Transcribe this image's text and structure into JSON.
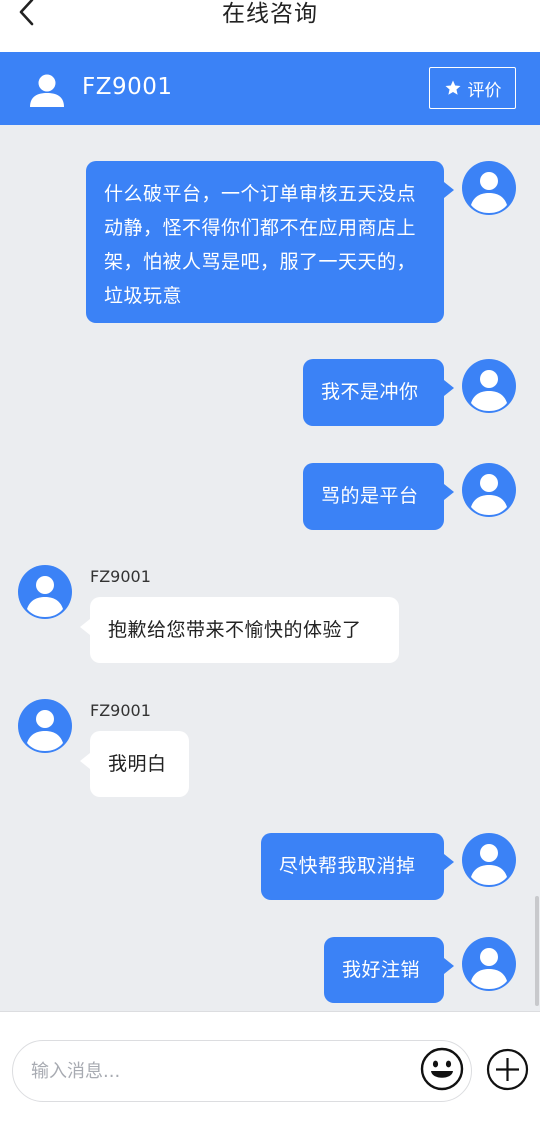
{
  "header": {
    "title": "在线咨询"
  },
  "agent_bar": {
    "name": "FZ9001",
    "rate_label": "评价"
  },
  "messages": [
    {
      "direction": "out",
      "text": "什么破平台，一个订单审核五天没点动静，怪不得你们都不在应用商店上架，怕被人骂是吧，服了一天天的，垃圾玩意"
    },
    {
      "direction": "out",
      "text": "我不是冲你"
    },
    {
      "direction": "out",
      "text": "骂的是平台"
    },
    {
      "direction": "in",
      "sender": "FZ9001",
      "text": "抱歉给您带来不愉快的体验了"
    },
    {
      "direction": "in",
      "sender": "FZ9001",
      "text": "我明白"
    },
    {
      "direction": "out",
      "text": "尽快帮我取消掉"
    },
    {
      "direction": "out",
      "text": "我好注销"
    }
  ],
  "composer": {
    "placeholder": "输入消息...",
    "value": ""
  },
  "icons": {
    "back": "chevron-left-icon",
    "user": "user-avatar-icon",
    "star": "star-icon",
    "emoji": "smiley-icon",
    "plus": "plus-circle-icon"
  },
  "colors": {
    "accent": "#3b82f6",
    "background": "#ebedf0",
    "bubble_in": "#ffffff",
    "avatar": "#3b82f6"
  }
}
